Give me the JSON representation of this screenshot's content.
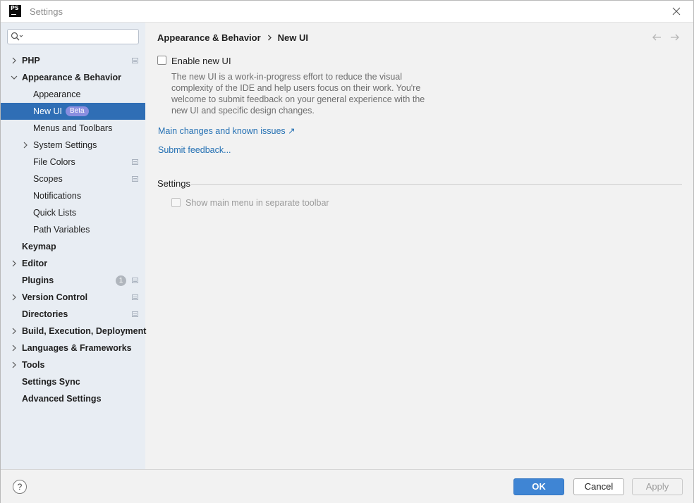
{
  "window": {
    "title": "Settings",
    "logo_text": "PS"
  },
  "search": {
    "placeholder": ""
  },
  "sidebar": {
    "items": [
      {
        "label": "PHP"
      },
      {
        "label": "Appearance & Behavior"
      },
      {
        "label": "Appearance"
      },
      {
        "label": "New UI",
        "badge": "Beta"
      },
      {
        "label": "Menus and Toolbars"
      },
      {
        "label": "System Settings"
      },
      {
        "label": "File Colors"
      },
      {
        "label": "Scopes"
      },
      {
        "label": "Notifications"
      },
      {
        "label": "Quick Lists"
      },
      {
        "label": "Path Variables"
      },
      {
        "label": "Keymap"
      },
      {
        "label": "Editor"
      },
      {
        "label": "Plugins",
        "count": "1"
      },
      {
        "label": "Version Control"
      },
      {
        "label": "Directories"
      },
      {
        "label": "Build, Execution, Deployment"
      },
      {
        "label": "Languages & Frameworks"
      },
      {
        "label": "Tools"
      },
      {
        "label": "Settings Sync"
      },
      {
        "label": "Advanced Settings"
      }
    ]
  },
  "main": {
    "breadcrumb": {
      "parent": "Appearance & Behavior",
      "current": "New UI"
    },
    "enable_new_ui": {
      "label": "Enable new UI",
      "checked": false
    },
    "description": "The new UI is a work-in-progress effort to reduce the visual complexity of the IDE and help users focus on their work. You're welcome to submit feedback on your general experience with the new UI and specific design changes.",
    "links": {
      "main_changes": "Main changes and known issues",
      "main_changes_arrow": "↗",
      "submit_feedback": "Submit feedback..."
    },
    "settings_section": {
      "title": "Settings",
      "show_main_menu_label": "Show main menu in separate toolbar",
      "show_main_menu_checked": false
    }
  },
  "footer": {
    "help": "?",
    "ok": "OK",
    "cancel": "Cancel",
    "apply": "Apply"
  },
  "colors": {
    "selection": "#2f6eb5",
    "link": "#2470b3",
    "ok_button": "#3f85d4",
    "beta_badge": "#8a8ee0",
    "sidebar_bg": "#e8edf3"
  }
}
